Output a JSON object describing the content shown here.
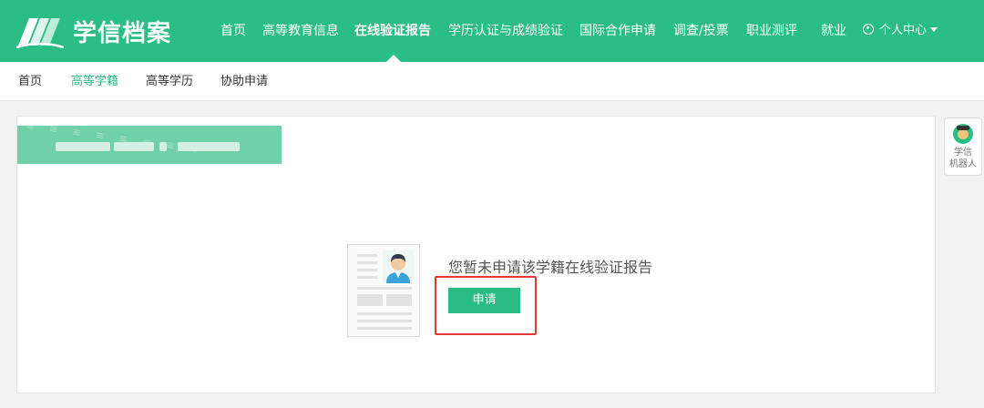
{
  "brand": {
    "name": "学信档案"
  },
  "nav": {
    "items": [
      "首页",
      "高等教育信息",
      "在线验证报告",
      "学历认证与成绩验证",
      "国际合作申请",
      "调查/投票",
      "职业测评",
      "就业"
    ],
    "active": "在线验证报告",
    "user_menu": "个人中心"
  },
  "subnav": {
    "items": [
      "首页",
      "高等学籍",
      "高等学历",
      "协助申请"
    ],
    "active": "高等学籍"
  },
  "main": {
    "message": "您暂未申请该学籍在线验证报告",
    "apply_label": "申请"
  },
  "robot": {
    "label": "学信\n机器人"
  },
  "colors": {
    "brand": "#2bbd86",
    "highlight": "#e53935",
    "banner": "#6fd0aa"
  }
}
